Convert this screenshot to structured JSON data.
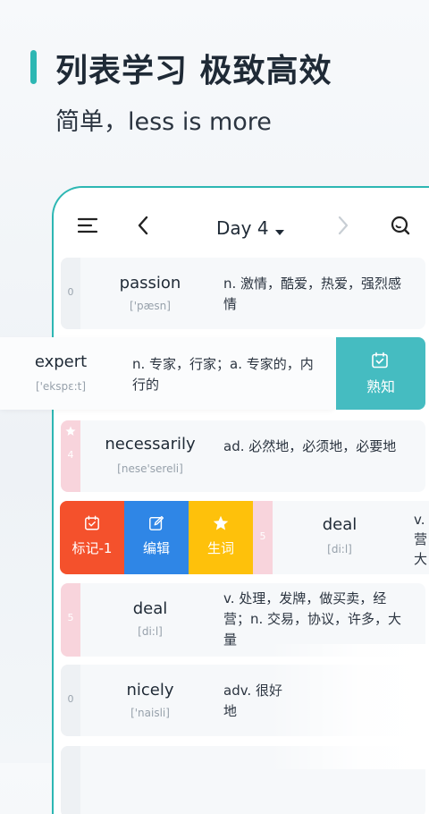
{
  "header": {
    "headline": "列表学习 极致高效",
    "subline": "简单，less is more"
  },
  "toolbar": {
    "menu_icon": "menu-icon",
    "back_icon": "chevron-left-icon",
    "day_title": "Day 4",
    "dropdown_icon": "caret-down-icon",
    "forward_icon": "chevron-right-icon",
    "search_icon": "search-icon"
  },
  "words": [
    {
      "num": "0",
      "word": "passion",
      "phonetic": "['pæsn]",
      "definition": "n. 激情，酷爱，热爱，强烈感情"
    },
    {
      "word": "expert",
      "phonetic": "['ekspɛ:t]",
      "definition": "n. 专家，行家；a. 专家的，内行的",
      "action_label": "熟知"
    },
    {
      "num": "4",
      "word": "necessarily",
      "phonetic": "[nese'sereli]",
      "definition": "ad. 必然地，必须地，必要地"
    },
    {
      "num": "5",
      "word": "deal",
      "phonetic": "[di:l]",
      "definition": "v. 营 大",
      "actions": {
        "mark": "标记-1",
        "edit": "编辑",
        "new_word": "生词"
      }
    },
    {
      "num": "5",
      "word": "deal",
      "phonetic": "[di:l]",
      "definition": "v. 处理，发牌，做买卖，经营；n. 交易，协议，许多，大量"
    },
    {
      "num": "0",
      "word": "nicely",
      "phonetic": "['naisli]",
      "definition": "adv. 很好地"
    }
  ],
  "colors": {
    "accent": "#2db7b3",
    "known": "#45bcc1",
    "mark": "#f4512c",
    "edit": "#2f86e6",
    "new_word": "#fec10b",
    "pink_strip": "#f8d4dc"
  }
}
